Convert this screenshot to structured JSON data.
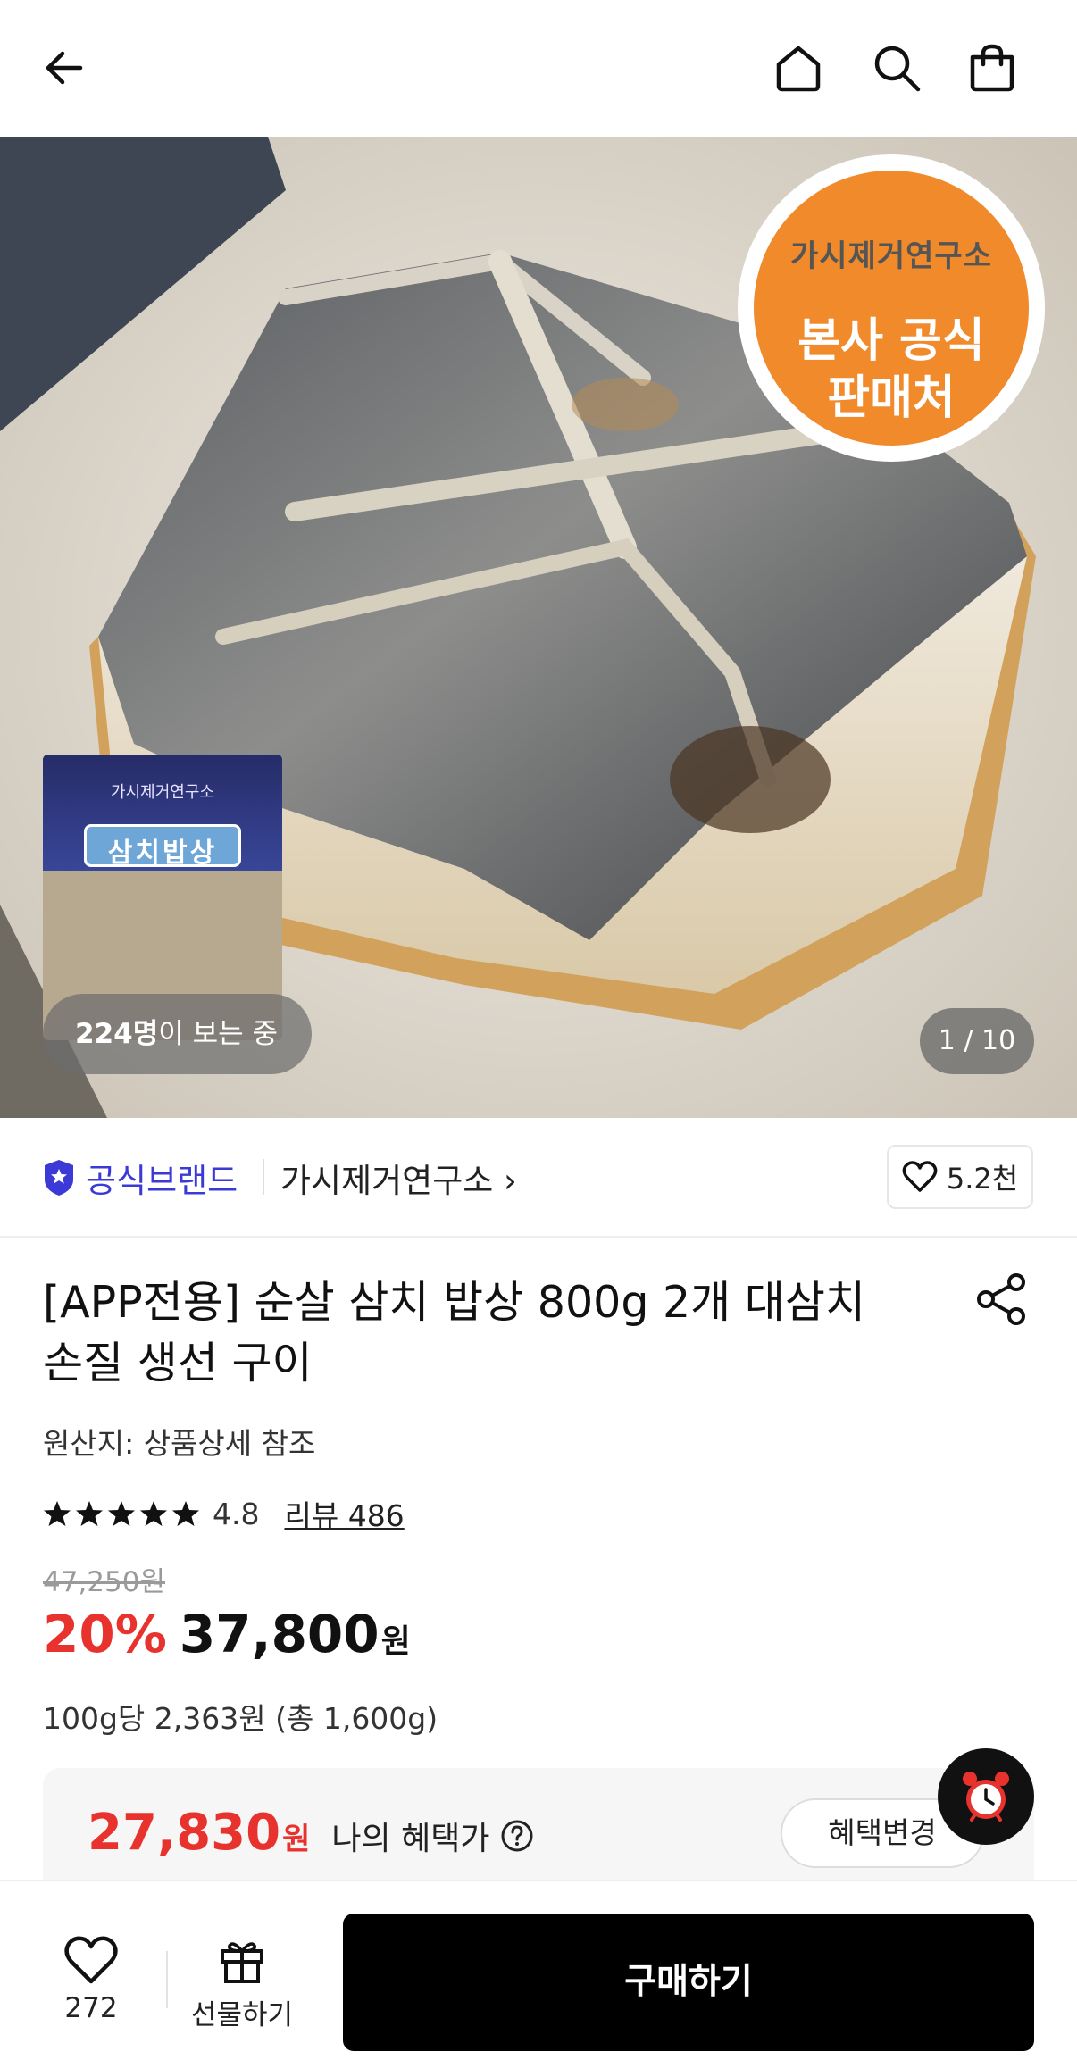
{
  "header": {
    "back_icon": "arrow-left-icon",
    "home_icon": "home-icon",
    "search_icon": "search-icon",
    "bag_icon": "shopping-bag-icon"
  },
  "hero": {
    "badge": {
      "brand": "가시제거연구소",
      "line1": "본사 공식",
      "line2": "판매처"
    },
    "package": {
      "brand": "가시제거연구소",
      "title": "삼치밥상"
    },
    "viewers_count": "224명",
    "viewers_suffix": "이 보는 중",
    "page_indicator": "1 / 10"
  },
  "brand_row": {
    "official_label": "공식브랜드",
    "store_name": "가시제거연구소 ›",
    "like_count": "5.2천"
  },
  "product": {
    "title": "[APP전용] 순살 삼치 밥상 800g 2개 대삼치 손질 생선 구이",
    "origin": "원산지: 상품상세 참조",
    "rating": "4.8",
    "stars": 5,
    "review_link": "리뷰 486",
    "original_price": "47,250원",
    "discount": "20%",
    "price": "37,800",
    "price_unit": "원",
    "unit_price": "100g당 2,363원 (총 1,600g)"
  },
  "benefit": {
    "price": "27,830",
    "price_unit": "원",
    "label": "나의 혜택가",
    "change_button": "혜택변경"
  },
  "bottom_bar": {
    "wish_count": "272",
    "gift_label": "선물하기",
    "buy_label": "구매하기"
  },
  "colors": {
    "accent_red": "#e8322e",
    "official_blue": "#3c3ad6",
    "badge_orange": "#f08a2b",
    "buy_button": "#000000"
  }
}
